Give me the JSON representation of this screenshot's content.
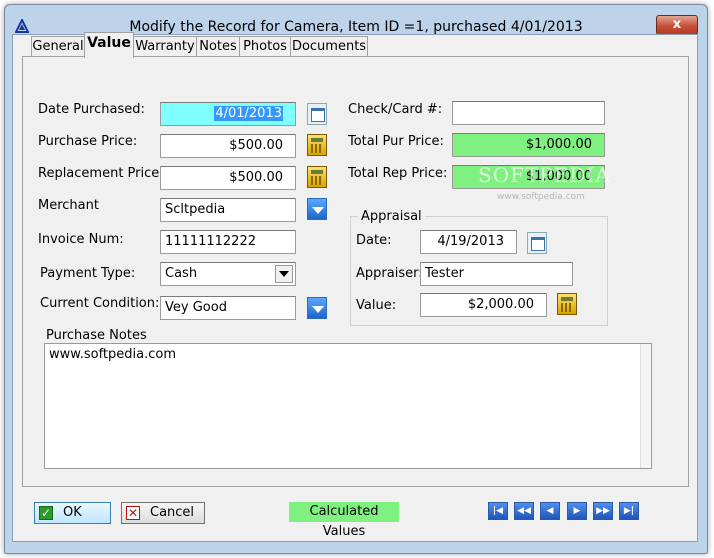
{
  "window": {
    "title": "Modify the Record for Camera, Item ID =1, purchased 4/01/2013",
    "close_label": "x"
  },
  "tabs": [
    {
      "label": "General"
    },
    {
      "label": "Value"
    },
    {
      "label": "Warranty"
    },
    {
      "label": "Notes"
    },
    {
      "label": "Photos"
    },
    {
      "label": "Documents"
    }
  ],
  "form": {
    "date_purchased": {
      "label": "Date Purchased:",
      "value": "4/01/2013"
    },
    "purchase_price": {
      "label": "Purchase Price:",
      "value": "$500.00"
    },
    "replacement_price": {
      "label": "Replacement Price:",
      "value": "$500.00"
    },
    "merchant": {
      "label": "Merchant",
      "value": "Scltpedia"
    },
    "invoice_num": {
      "label": "Invoice Num:",
      "value": "11111112222"
    },
    "payment_type": {
      "label": "Payment Type:",
      "value": "Cash"
    },
    "current_condition": {
      "label": "Current Condition:",
      "value": "Vey Good"
    },
    "check_card": {
      "label": "Check/Card #:",
      "value": ""
    },
    "total_pur_price": {
      "label": "Total Pur Price:",
      "value": "$1,000.00"
    },
    "total_rep_price": {
      "label": "Total Rep Price:",
      "value": "$1,000.00"
    }
  },
  "appraisal": {
    "title": "Appraisal",
    "date": {
      "label": "Date:",
      "value": "4/19/2013"
    },
    "appraiser": {
      "label": "Appraiser:",
      "value": "Tester"
    },
    "value": {
      "label": "Value:",
      "value": "$2,000.00"
    }
  },
  "notes": {
    "label": "Purchase Notes",
    "value": "www.softpedia.com"
  },
  "watermark": {
    "text": "SOFTPEDIA",
    "url": "www.softpedia.com"
  },
  "footer": {
    "ok_label": "OK",
    "cancel_label": "Cancel",
    "calculated_label": "Calculated Values",
    "nav": [
      "|◀",
      "◀◀",
      "◀",
      "▶",
      "▶▶",
      "▶|"
    ]
  },
  "colors": {
    "calculated": "#80f080",
    "selected_field": "#80ffff",
    "dropdown_button": "#1d66c9"
  }
}
